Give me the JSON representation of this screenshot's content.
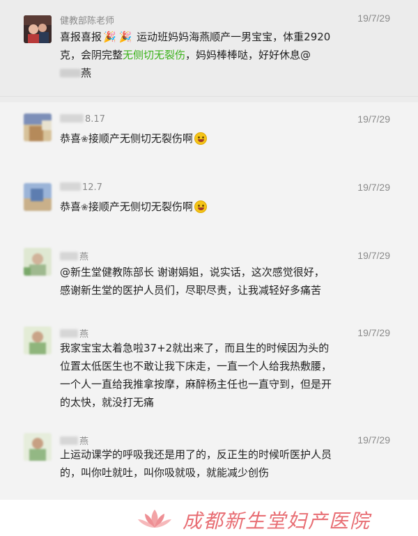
{
  "messages": [
    {
      "name": "健教部陈老师",
      "date": "19/7/29",
      "text_parts": [
        "喜报喜报",
        " 运动班妈妈海燕顺产一男宝宝，体重2920克，会阴完整",
        "无侧切无裂伤",
        "，妈妈棒棒哒，好好休息@",
        "燕"
      ],
      "icons": [
        "party-popper-icon",
        "party-popper-icon"
      ]
    },
    {
      "name_suffix": "8.17",
      "date": "19/7/29",
      "text_parts": [
        "恭喜",
        "接顺产无侧切无裂伤啊"
      ],
      "icons": [
        "flower-icon",
        "grin-emoji-icon"
      ]
    },
    {
      "name_suffix": "12.7",
      "date": "19/7/29",
      "text_parts": [
        "恭喜",
        "接顺产无侧切无裂伤啊"
      ],
      "icons": [
        "flower-icon",
        "grin-emoji-icon"
      ]
    },
    {
      "name_suffix": "燕",
      "date": "19/7/29",
      "text": "@新生堂健教陈部长 谢谢娟姐，说实话，这次感觉很好，感谢新生堂的医护人员们，尽职尽责，让我减轻好多痛苦"
    },
    {
      "name_suffix": "燕",
      "date": "19/7/29",
      "text": "我家宝宝太着急啦37+2就出来了，而且生的时候因为头的位置太低医生也不敢让我下床走，一直一个人给我热敷腰，一个人一直给我推拿按摩，麻醉杨主任也一直守到，但是开的太快，就没打无痛"
    },
    {
      "name_suffix": "燕",
      "date": "19/7/29",
      "text": "上运动课学的呼吸我还是用了的，反正生的时候听医护人员的，叫你吐就吐，叫你吸就吸，就能减少创伤"
    }
  ],
  "footer": {
    "brand": "成都新生堂妇产医院",
    "logo": "lotus-logo-icon"
  },
  "colors": {
    "highlight_text": "#3bb21a",
    "brand": "#e86d73",
    "highlight_bg": "#ececec",
    "row_bg": "#f3f3f3"
  }
}
